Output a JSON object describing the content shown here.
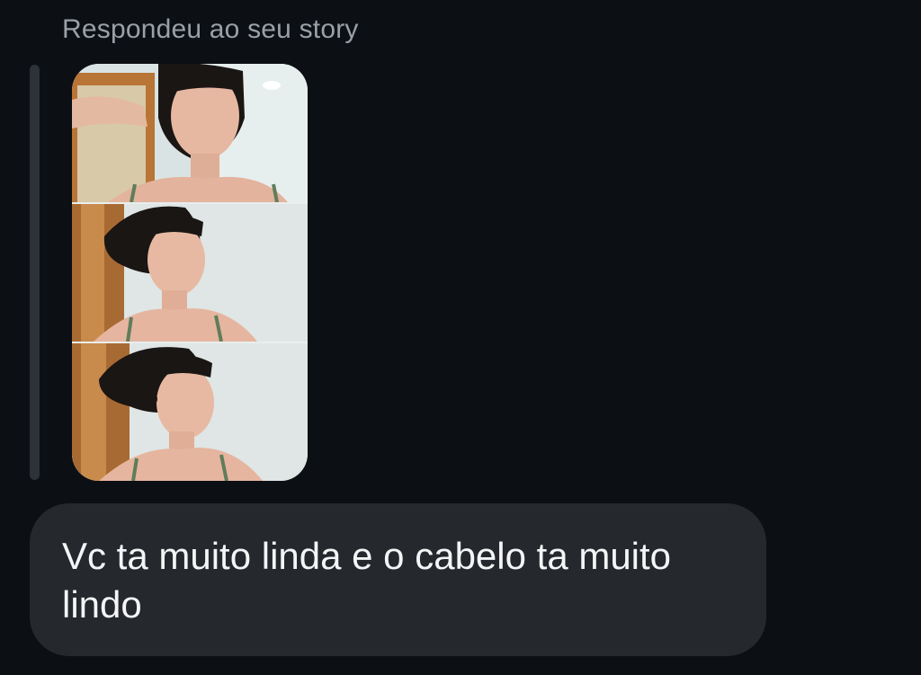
{
  "reply_context": {
    "caption": "Respondeu ao seu story",
    "story_thumbnail": {
      "panels": [
        "photo-1",
        "photo-2",
        "photo-3"
      ]
    }
  },
  "message": {
    "text": "Vc ta muito linda e o cabelo ta muito lindo"
  },
  "colors": {
    "background": "#0c0f13",
    "bubble": "#25282d",
    "caption": "#9aa0a8",
    "message_text": "#f4f5f6"
  }
}
